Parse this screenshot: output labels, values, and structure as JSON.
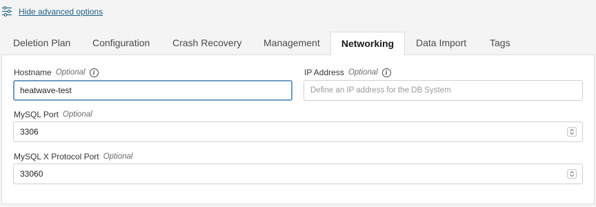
{
  "advanced": {
    "label": "Hide advanced options",
    "icon": "sliders-icon"
  },
  "tabs": [
    {
      "label": "Deletion Plan"
    },
    {
      "label": "Configuration"
    },
    {
      "label": "Crash Recovery"
    },
    {
      "label": "Management"
    },
    {
      "label": "Networking",
      "active": true
    },
    {
      "label": "Data Import"
    },
    {
      "label": "Tags"
    }
  ],
  "form": {
    "hostname": {
      "label": "Hostname",
      "optional": "Optional",
      "value": "heatwave-test",
      "icon": "info-icon"
    },
    "ip_address": {
      "label": "IP Address",
      "optional": "Optional",
      "placeholder": "Define an IP address for the DB System",
      "icon": "info-icon"
    },
    "mysql_port": {
      "label": "MySQL Port",
      "optional": "Optional",
      "value": "3306"
    },
    "mysqlx_port": {
      "label": "MySQL X Protocol Port",
      "optional": "Optional",
      "value": "33060"
    }
  },
  "colors": {
    "link": "#1f5f86",
    "focus": "#6f9ac2",
    "background": "#f4f4f4"
  }
}
